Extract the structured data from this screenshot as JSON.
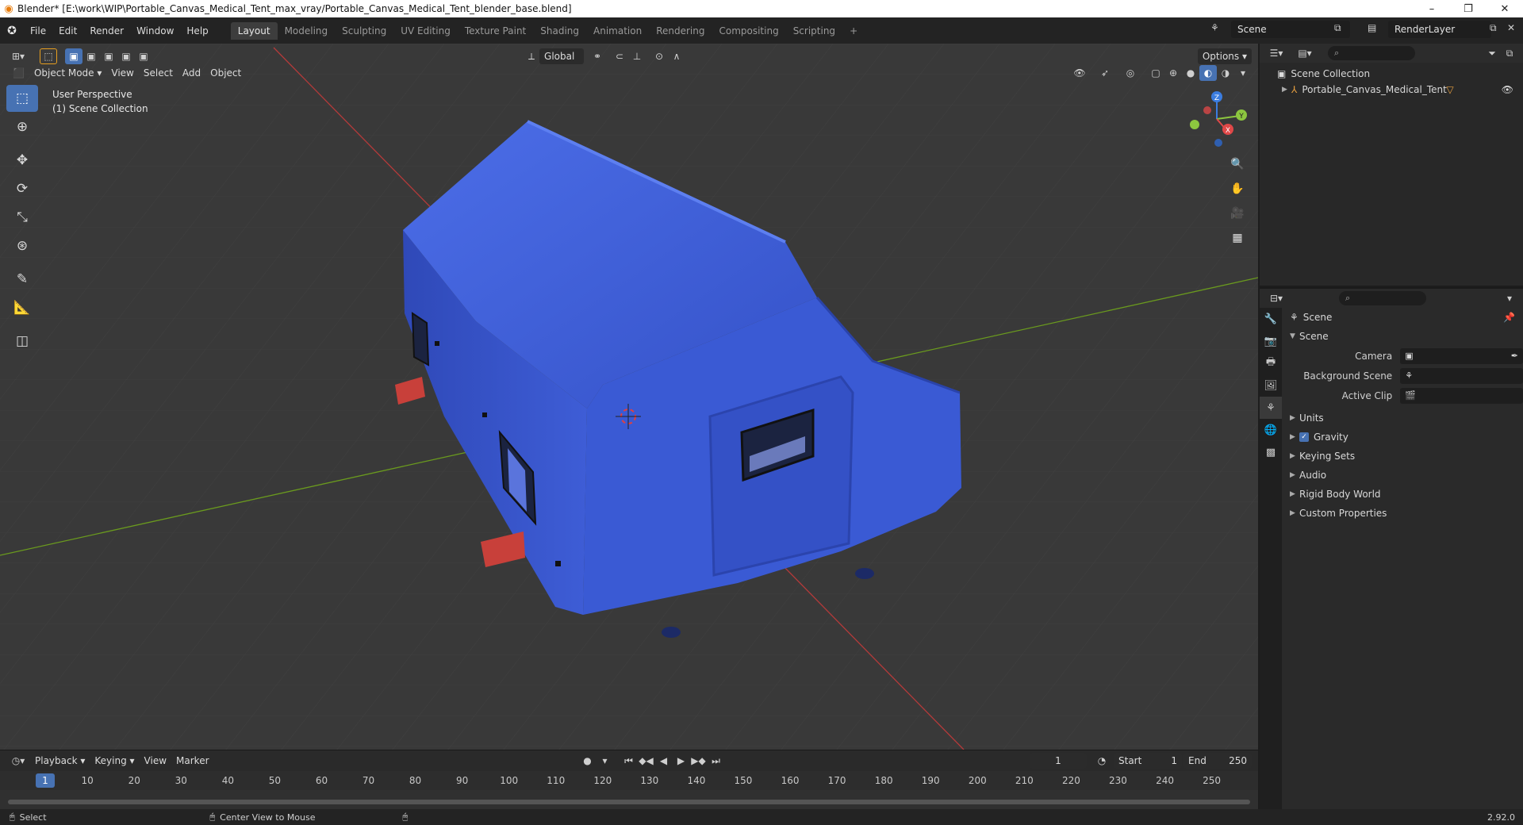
{
  "window": {
    "title": "Blender* [E:\\work\\WIP\\Portable_Canvas_Medical_Tent_max_vray/Portable_Canvas_Medical_Tent_blender_base.blend]",
    "controls": [
      "–",
      "❐",
      "✕"
    ]
  },
  "menu": {
    "items": [
      "File",
      "Edit",
      "Render",
      "Window",
      "Help"
    ]
  },
  "workspaces": {
    "tabs": [
      "Layout",
      "Modeling",
      "Sculpting",
      "UV Editing",
      "Texture Paint",
      "Shading",
      "Animation",
      "Rendering",
      "Compositing",
      "Scripting"
    ],
    "active": "Layout",
    "add_label": "+"
  },
  "scene_selector": {
    "value": "Scene"
  },
  "renderlayer_selector": {
    "value": "RenderLayer"
  },
  "viewport": {
    "mode": "Object Mode",
    "menus": [
      "View",
      "Select",
      "Add",
      "Object"
    ],
    "orientation": "Global",
    "options_label": "Options",
    "overlay_line1": "User Perspective",
    "overlay_line2": "(1) Scene Collection",
    "gizmo_axes": {
      "x": "X",
      "y": "Y",
      "z": "Z"
    },
    "colors": {
      "background": "#393939",
      "x_axis": "#c23a3a",
      "y_axis": "#6a9a1e",
      "tent_blue": "#3a5cd6",
      "tent_red": "#c8403a",
      "accent": "#4772b3"
    }
  },
  "timeline": {
    "menus": [
      "Playback",
      "Keying",
      "View",
      "Marker"
    ],
    "current_frame": "1",
    "start_label": "Start",
    "start_value": "1",
    "end_label": "End",
    "end_value": "250",
    "ticks": [
      "1",
      "10",
      "20",
      "30",
      "40",
      "50",
      "60",
      "70",
      "80",
      "90",
      "100",
      "110",
      "120",
      "130",
      "140",
      "150",
      "160",
      "170",
      "180",
      "190",
      "200",
      "210",
      "220",
      "230",
      "240",
      "250"
    ]
  },
  "status": {
    "select_label": "Select",
    "center_label": "Center View to Mouse",
    "version": "2.92.0"
  },
  "outliner": {
    "root": "Scene Collection",
    "items": [
      {
        "label": "Portable_Canvas_Medical_Tent"
      }
    ]
  },
  "properties": {
    "context": "Scene",
    "section": "Scene",
    "fields": [
      {
        "label": "Camera",
        "value": ""
      },
      {
        "label": "Background Scene",
        "value": ""
      },
      {
        "label": "Active Clip",
        "value": ""
      }
    ],
    "panels": [
      "Units",
      "Gravity",
      "Keying Sets",
      "Audio",
      "Rigid Body World",
      "Custom Properties"
    ],
    "gravity_checked": true
  }
}
